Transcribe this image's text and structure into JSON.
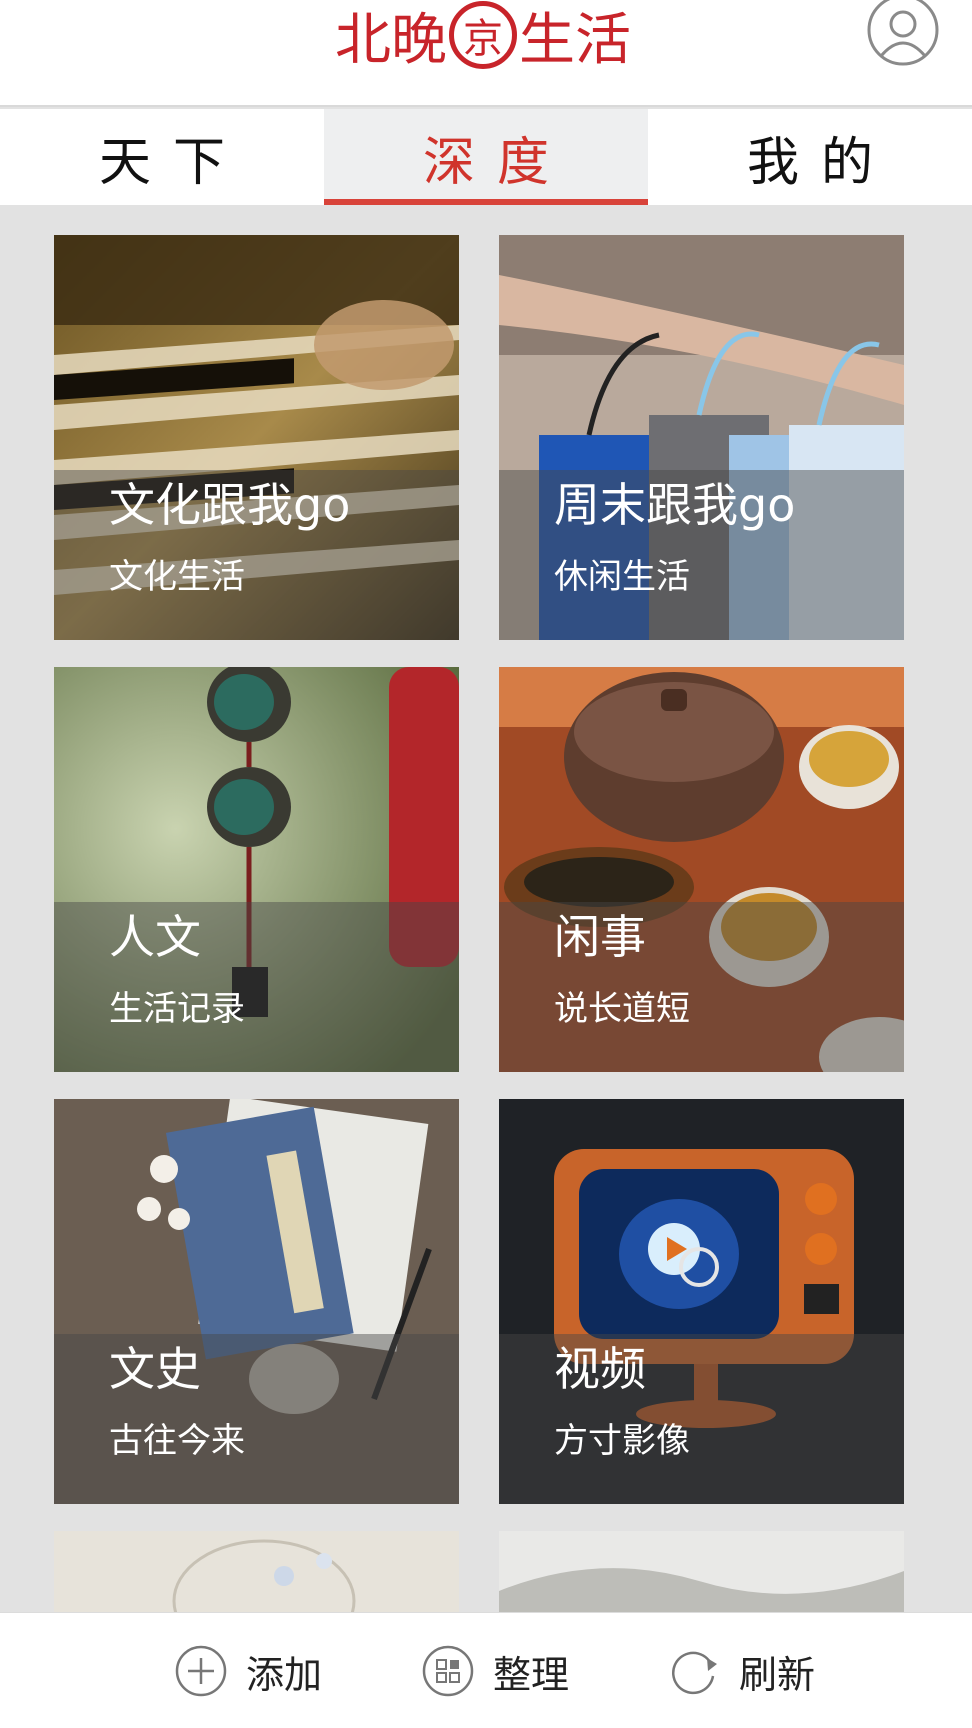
{
  "header": {
    "logo": {
      "text_before": "北晚",
      "circled_char": "京",
      "text_after": "生活",
      "color": "#c8242a"
    },
    "profile_icon": "user-icon"
  },
  "tabs": [
    {
      "label": "天下",
      "active": false
    },
    {
      "label": "深度",
      "active": true
    },
    {
      "label": "我的",
      "active": false
    }
  ],
  "accent_color": "#d0342c",
  "cards": [
    {
      "title": "文化跟我go",
      "subtitle": "文化生活",
      "image": "piano-keys-photo"
    },
    {
      "title": "周末跟我go",
      "subtitle": "休闲生活",
      "image": "shopping-bags-photo"
    },
    {
      "title": "人文",
      "subtitle": "生活记录",
      "image": "wind-chime-photo"
    },
    {
      "title": "闲事",
      "subtitle": "说长道短",
      "image": "tea-set-photo"
    },
    {
      "title": "文史",
      "subtitle": "古往今来",
      "image": "old-books-photo"
    },
    {
      "title": "视频",
      "subtitle": "方寸影像",
      "image": "retro-tv-photo"
    }
  ],
  "toolbar": {
    "add_label": "添加",
    "add_icon": "plus-circle-icon",
    "organize_label": "整理",
    "organize_icon": "grid-circle-icon",
    "refresh_label": "刷新",
    "refresh_icon": "refresh-icon"
  }
}
